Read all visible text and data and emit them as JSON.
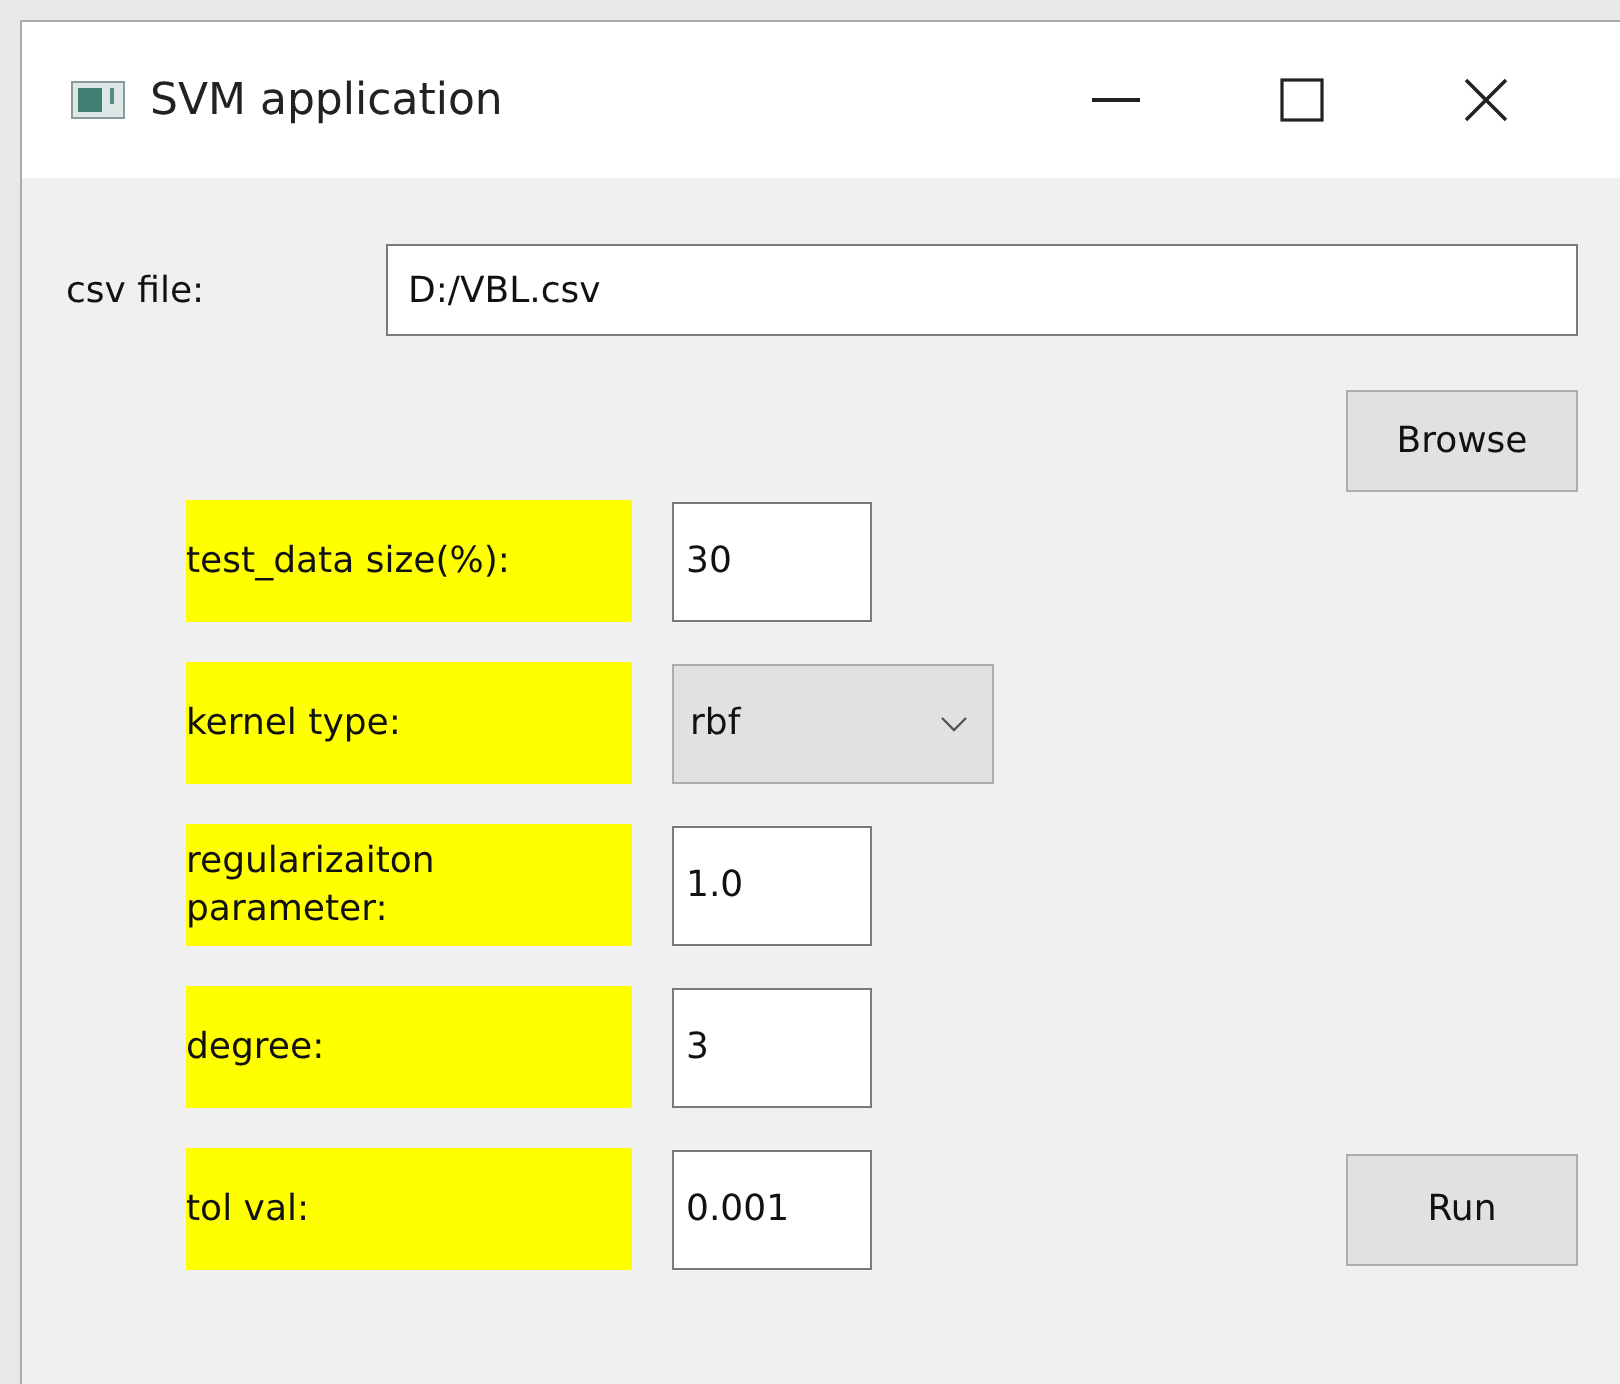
{
  "window": {
    "title": "SVM application"
  },
  "file": {
    "label": "csv file:",
    "value": "D:/VBL.csv"
  },
  "browse_button": "Browse",
  "params": [
    {
      "label": "test_data size(%):",
      "kind": "input",
      "value": "30"
    },
    {
      "label": "kernel type:",
      "kind": "combo",
      "value": "rbf"
    },
    {
      "label": "regularizaiton parameter:",
      "kind": "input",
      "value": "1.0"
    },
    {
      "label": "degree:",
      "kind": "input",
      "value": "3"
    },
    {
      "label": "tol val:",
      "kind": "input",
      "value": "0.001"
    }
  ],
  "run_button": "Run"
}
